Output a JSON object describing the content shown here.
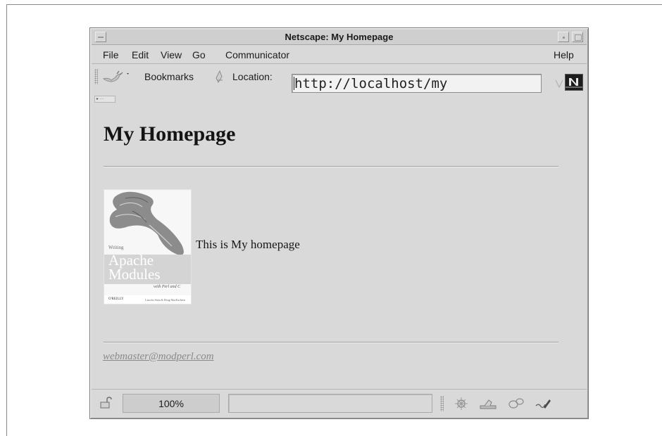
{
  "window": {
    "title": "Netscape: My Homepage"
  },
  "menubar": {
    "items": [
      "File",
      "Edit",
      "View",
      "Go",
      "Communicator",
      "Help"
    ]
  },
  "toolbar": {
    "bookmarks_label": "Bookmarks",
    "location_label": "Location:",
    "url": "http://localhost/my",
    "icons": [
      "bookmarks-icon",
      "location-icon",
      "url-dropdown-icon",
      "netscape-logo-icon"
    ]
  },
  "page": {
    "heading": "My Homepage",
    "body_text": "This is My homepage",
    "book_cover": {
      "line_small": "Writing",
      "line_big_1": "Apache",
      "line_big_2": "Modules",
      "line_sub": "with Perl and C",
      "publisher": "O'REILLY",
      "authors": "Lincoln Stein & Doug MacEachern"
    },
    "footer_email": "webmaster@modperl.com"
  },
  "statusbar": {
    "zoom": "100%",
    "icons": [
      "security-lock-icon",
      "navigator-icon",
      "mail-icon",
      "discussions-icon",
      "composer-icon"
    ]
  },
  "colors": {
    "window_bg": "#d9d9d9",
    "link": "#8a8a8a",
    "text": "#161616"
  }
}
